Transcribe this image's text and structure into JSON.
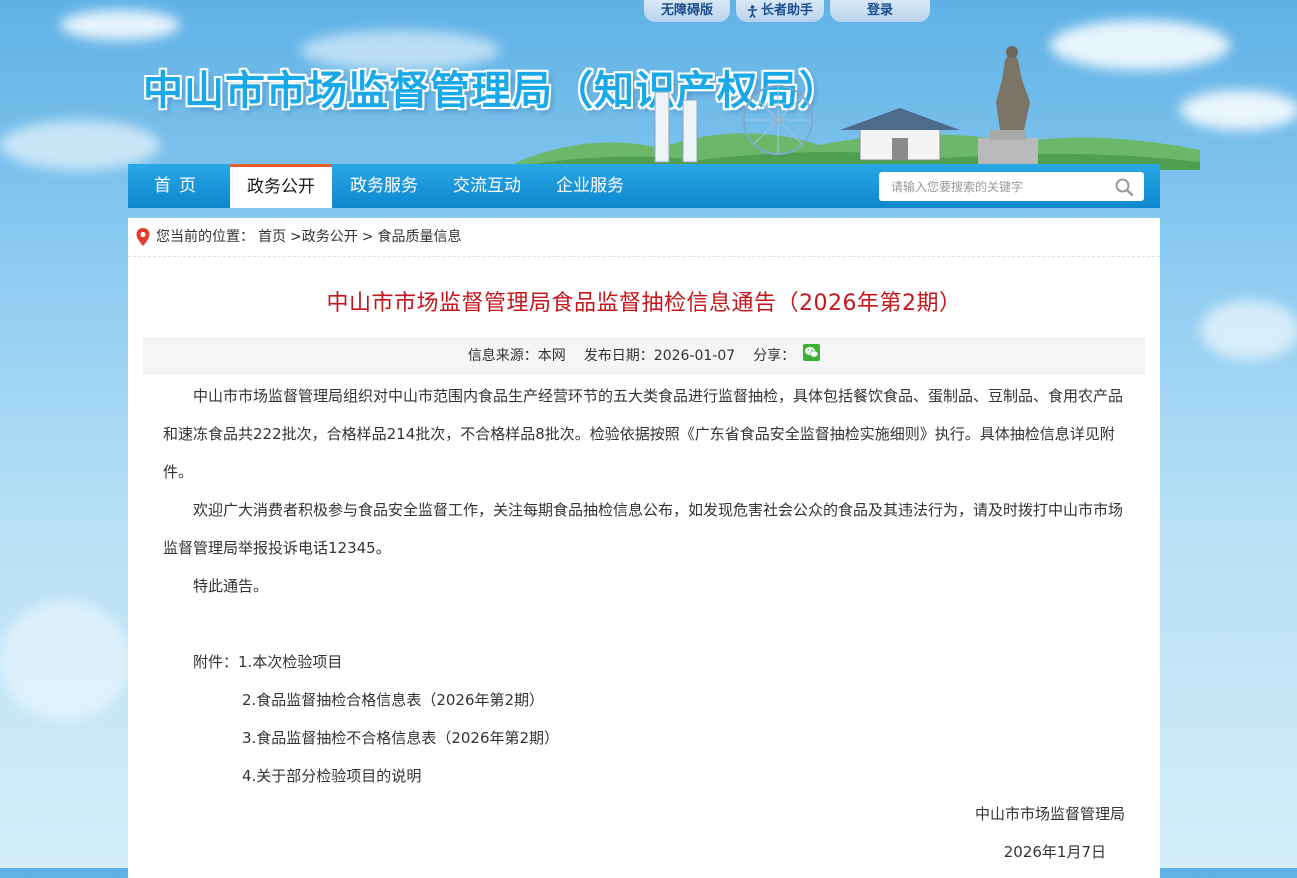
{
  "topbar": {
    "accessibility": "无障碍版",
    "elder_helper": "长者助手",
    "login": "登录"
  },
  "site": {
    "title": "中山市市场监督管理局（知识产权局）"
  },
  "nav": {
    "items": [
      {
        "label": "首页"
      },
      {
        "label": "政务公开"
      },
      {
        "label": "政务服务"
      },
      {
        "label": "交流互动"
      },
      {
        "label": "企业服务"
      }
    ],
    "active": "政务公开",
    "search_placeholder": "请输入您要搜索的关键字"
  },
  "breadcrumb": {
    "prefix": "您当前的位置：",
    "items": [
      "首页",
      ">政务公开",
      ">",
      "食品质量信息"
    ]
  },
  "article": {
    "title": "中山市市场监督管理局食品监督抽检信息通告（2026年第2期）",
    "meta": {
      "source": "信息来源：本网",
      "date": "发布日期：2026-01-07",
      "share": "分享："
    },
    "paragraphs": [
      "中山市市场监督管理局组织对中山市范围内食品生产经营环节的五大类食品进行监督抽检，具体包括餐饮食品、蛋制品、豆制品、食用农产品和速冻食品共222批次，合格样品214批次，不合格样品8批次。检验依据按照《广东省食品安全监督抽检实施细则》执行。具体抽检信息详见附件。",
      "欢迎广大消费者积极参与食品安全监督工作，关注每期食品抽检信息公布，如发现危害社会公众的食品及其违法行为，请及时拨打中山市市场监督管理局举报投诉电话12345。",
      "特此通告。"
    ],
    "attachments": {
      "label": "附件：",
      "items": [
        "1.本次检验项目",
        "2.食品监督抽检合格信息表（2026年第2期）",
        "3.食品监督抽检不合格信息表（2026年第2期）",
        "4.关于部分检验项目的说明"
      ]
    },
    "signature": "中山市市场监督管理局",
    "sign_date": "2026年1月7日"
  },
  "colors": {
    "nav_blue": "#1a98dc",
    "title_red": "#c4161c",
    "active_top": "#e65d2b"
  }
}
